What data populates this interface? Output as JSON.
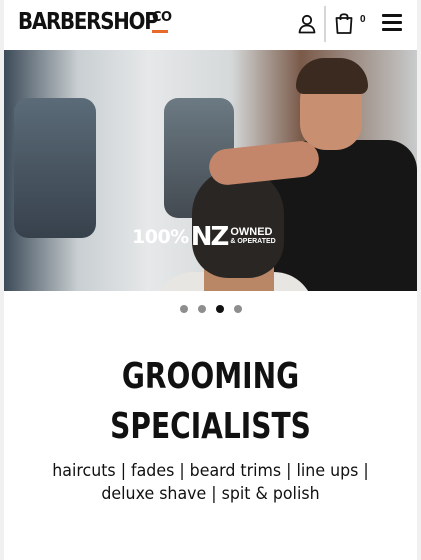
{
  "header": {
    "logo_text": "BARBERSHOP",
    "logo_suffix": "CO",
    "user_icon": "user-icon",
    "cart_icon": "shopping-bag-icon",
    "cart_count": "0",
    "menu_icon": "hamburger-menu-icon"
  },
  "hero": {
    "badge_percent": "100%",
    "badge_country": "NZ",
    "badge_owned": "OWNED",
    "badge_operated": "& OPERATED"
  },
  "carousel": {
    "slide_count": 4,
    "active_index": 2
  },
  "content": {
    "headline_line1": "GROOMING",
    "headline_line2": "SPECIALISTS",
    "tagline_line1": "haircuts | fades | beard trims | line ups |",
    "tagline_line2": "deluxe shave | spit & polish"
  },
  "colors": {
    "accent": "#e86a2a",
    "text": "#111111",
    "dot_inactive": "#8e8e8e",
    "dot_active": "#111111"
  }
}
